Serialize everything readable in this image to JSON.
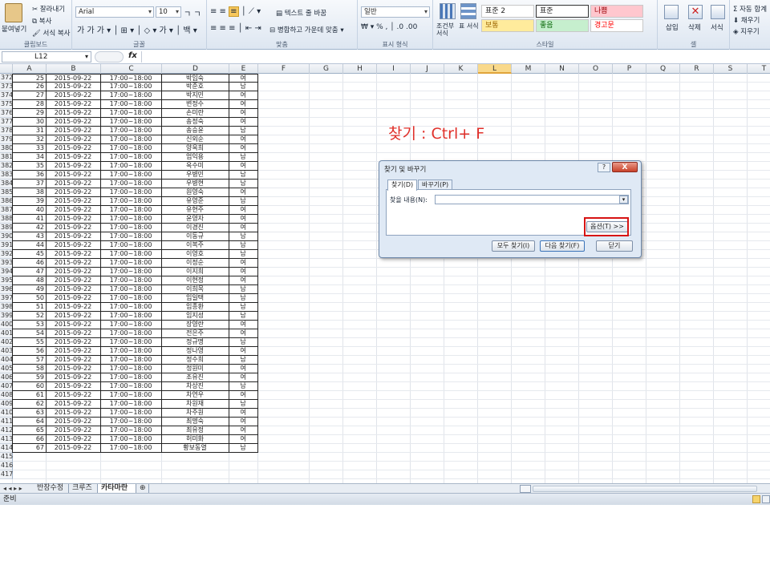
{
  "ribbon": {
    "clipboard": {
      "paste": "붙여넣기",
      "cut": "잘라내기",
      "copy": "복사",
      "format_painter": "서식 복사",
      "label": "클립보드"
    },
    "font": {
      "name": "Arial",
      "size": "10",
      "label": "글꼴"
    },
    "alignment": {
      "wrap": "텍스트 줄 바꿈",
      "merge": "병합하고 가운데 맞춤",
      "label": "맞춤"
    },
    "number": {
      "format": "일반",
      "label": "표시 형식"
    },
    "styles": {
      "conditional": "조건부 서식",
      "table": "표 서식",
      "cells": [
        {
          "text": "표준 2",
          "bg": "#ffffff",
          "color": "#222222"
        },
        {
          "text": "표준",
          "bg": "#ffffff",
          "color": "#222222"
        },
        {
          "text": "나쁨",
          "bg": "#ffc7ce",
          "color": "#9c0006"
        },
        {
          "text": "보통",
          "bg": "#ffeb9c",
          "color": "#9c6500"
        },
        {
          "text": "좋음",
          "bg": "#c6efce",
          "color": "#006100"
        },
        {
          "text": "경고문",
          "bg": "#ffffff",
          "color": "#ff0000"
        }
      ],
      "label": "스타일"
    },
    "cells_group": {
      "insert": "삽입",
      "delete": "삭제",
      "format": "서식",
      "label": "셀"
    },
    "editing": {
      "autosum": "자동 합계",
      "fill": "채우기",
      "clear": "지우기"
    }
  },
  "formula_bar": {
    "name_box": "L12",
    "fx": "fx"
  },
  "columns": [
    "A",
    "B",
    "C",
    "D",
    "E",
    "F",
    "G",
    "H",
    "I",
    "J",
    "K",
    "L",
    "M",
    "N",
    "O",
    "P",
    "Q",
    "R",
    "S",
    "T"
  ],
  "selected_column": "L",
  "rows": [
    {
      "r": "372",
      "n": "25",
      "date": "2015-09-22",
      "time": "17:00~18:00",
      "name": "박임숙",
      "g": "여"
    },
    {
      "r": "373",
      "n": "26",
      "date": "2015-09-22",
      "time": "17:00~18:00",
      "name": "박준호",
      "g": "남"
    },
    {
      "r": "374",
      "n": "27",
      "date": "2015-09-22",
      "time": "17:00~18:00",
      "name": "박지민",
      "g": "여"
    },
    {
      "r": "375",
      "n": "28",
      "date": "2015-09-22",
      "time": "17:00~18:00",
      "name": "변정수",
      "g": "여"
    },
    {
      "r": "376",
      "n": "29",
      "date": "2015-09-22",
      "time": "17:00~18:00",
      "name": "손미란",
      "g": "여"
    },
    {
      "r": "377",
      "n": "30",
      "date": "2015-09-22",
      "time": "17:00~18:00",
      "name": "송정숙",
      "g": "여"
    },
    {
      "r": "378",
      "n": "31",
      "date": "2015-09-22",
      "time": "17:00~18:00",
      "name": "송승윤",
      "g": "남"
    },
    {
      "r": "379",
      "n": "32",
      "date": "2015-09-22",
      "time": "17:00~18:00",
      "name": "신외순",
      "g": "여"
    },
    {
      "r": "380",
      "n": "33",
      "date": "2015-09-22",
      "time": "17:00~18:00",
      "name": "양옥희",
      "g": "여"
    },
    {
      "r": "381",
      "n": "34",
      "date": "2015-09-22",
      "time": "17:00~18:00",
      "name": "엄익용",
      "g": "남"
    },
    {
      "r": "382",
      "n": "35",
      "date": "2015-09-22",
      "time": "17:00~18:00",
      "name": "옥수미",
      "g": "여"
    },
    {
      "r": "383",
      "n": "36",
      "date": "2015-09-22",
      "time": "17:00~18:00",
      "name": "우병민",
      "g": "남"
    },
    {
      "r": "384",
      "n": "37",
      "date": "2015-09-22",
      "time": "17:00~18:00",
      "name": "우병현",
      "g": "남"
    },
    {
      "r": "385",
      "n": "38",
      "date": "2015-09-22",
      "time": "17:00~18:00",
      "name": "원영숙",
      "g": "여"
    },
    {
      "r": "386",
      "n": "39",
      "date": "2015-09-22",
      "time": "17:00~18:00",
      "name": "유영준",
      "g": "남"
    },
    {
      "r": "387",
      "n": "40",
      "date": "2015-09-22",
      "time": "17:00~18:00",
      "name": "유현주",
      "g": "여"
    },
    {
      "r": "388",
      "n": "41",
      "date": "2015-09-22",
      "time": "17:00~18:00",
      "name": "윤영자",
      "g": "여"
    },
    {
      "r": "389",
      "n": "42",
      "date": "2015-09-22",
      "time": "17:00~18:00",
      "name": "이경진",
      "g": "여"
    },
    {
      "r": "390",
      "n": "43",
      "date": "2015-09-22",
      "time": "17:00~18:00",
      "name": "이동규",
      "g": "남"
    },
    {
      "r": "391",
      "n": "44",
      "date": "2015-09-22",
      "time": "17:00~18:00",
      "name": "이복주",
      "g": "남"
    },
    {
      "r": "392",
      "n": "45",
      "date": "2015-09-22",
      "time": "17:00~18:00",
      "name": "이영호",
      "g": "남"
    },
    {
      "r": "393",
      "n": "46",
      "date": "2015-09-22",
      "time": "17:00~18:00",
      "name": "이정순",
      "g": "여"
    },
    {
      "r": "394",
      "n": "47",
      "date": "2015-09-22",
      "time": "17:00~18:00",
      "name": "이지희",
      "g": "여"
    },
    {
      "r": "395",
      "n": "48",
      "date": "2015-09-22",
      "time": "17:00~18:00",
      "name": "이현정",
      "g": "여"
    },
    {
      "r": "396",
      "n": "49",
      "date": "2015-09-22",
      "time": "17:00~18:00",
      "name": "이희목",
      "g": "남"
    },
    {
      "r": "397",
      "n": "50",
      "date": "2015-09-22",
      "time": "17:00~18:00",
      "name": "임일택",
      "g": "남"
    },
    {
      "r": "398",
      "n": "51",
      "date": "2015-09-22",
      "time": "17:00~18:00",
      "name": "임종환",
      "g": "남"
    },
    {
      "r": "399",
      "n": "52",
      "date": "2015-09-22",
      "time": "17:00~18:00",
      "name": "임지성",
      "g": "남"
    },
    {
      "r": "400",
      "n": "53",
      "date": "2015-09-22",
      "time": "17:00~18:00",
      "name": "장영란",
      "g": "여"
    },
    {
      "r": "401",
      "n": "54",
      "date": "2015-09-22",
      "time": "17:00~18:00",
      "name": "전은주",
      "g": "여"
    },
    {
      "r": "402",
      "n": "55",
      "date": "2015-09-22",
      "time": "17:00~18:00",
      "name": "정규명",
      "g": "남"
    },
    {
      "r": "403",
      "n": "56",
      "date": "2015-09-22",
      "time": "17:00~18:00",
      "name": "정나영",
      "g": "여"
    },
    {
      "r": "404",
      "n": "57",
      "date": "2015-09-22",
      "time": "17:00~18:00",
      "name": "정수희",
      "g": "남"
    },
    {
      "r": "405",
      "n": "58",
      "date": "2015-09-22",
      "time": "17:00~18:00",
      "name": "정원미",
      "g": "여"
    },
    {
      "r": "406",
      "n": "59",
      "date": "2015-09-22",
      "time": "17:00~18:00",
      "name": "조유진",
      "g": "여"
    },
    {
      "r": "407",
      "n": "60",
      "date": "2015-09-22",
      "time": "17:00~18:00",
      "name": "차상진",
      "g": "남"
    },
    {
      "r": "408",
      "n": "61",
      "date": "2015-09-22",
      "time": "17:00~18:00",
      "name": "차연우",
      "g": "여"
    },
    {
      "r": "409",
      "n": "62",
      "date": "2015-09-22",
      "time": "17:00~18:00",
      "name": "차원재",
      "g": "남"
    },
    {
      "r": "410",
      "n": "63",
      "date": "2015-09-22",
      "time": "17:00~18:00",
      "name": "차주원",
      "g": "여"
    },
    {
      "r": "411",
      "n": "64",
      "date": "2015-09-22",
      "time": "17:00~18:00",
      "name": "최명숙",
      "g": "여"
    },
    {
      "r": "412",
      "n": "65",
      "date": "2015-09-22",
      "time": "17:00~18:00",
      "name": "최유정",
      "g": "여"
    },
    {
      "r": "413",
      "n": "66",
      "date": "2015-09-22",
      "time": "17:00~18:00",
      "name": "허미화",
      "g": "여"
    },
    {
      "r": "414",
      "n": "67",
      "date": "2015-09-22",
      "time": "17:00~18:00",
      "name": "황보동열",
      "g": "남"
    }
  ],
  "empty_rows": [
    "415",
    "416",
    "417"
  ],
  "sheet_tabs": [
    "반장수정",
    "크루즈",
    "카타마란"
  ],
  "active_tab": "카타마란",
  "status": "준비",
  "hint_text": "찾기 : Ctrl+ F",
  "dialog": {
    "title": "찾기 및 바꾸기",
    "help": "?",
    "close": "X",
    "tab_find": "찾기(D)",
    "tab_replace": "바꾸기(P)",
    "find_label": "찾을 내용(N):",
    "find_value": "",
    "options_button": "옵션(T) >>",
    "find_all": "모두 찾기(I)",
    "find_next": "다음 찾기(F)",
    "close_button": "닫기"
  },
  "colors": {
    "highlight_red": "#d71414",
    "hint_red": "#e0302a",
    "selected_col": "#f9d98b"
  }
}
